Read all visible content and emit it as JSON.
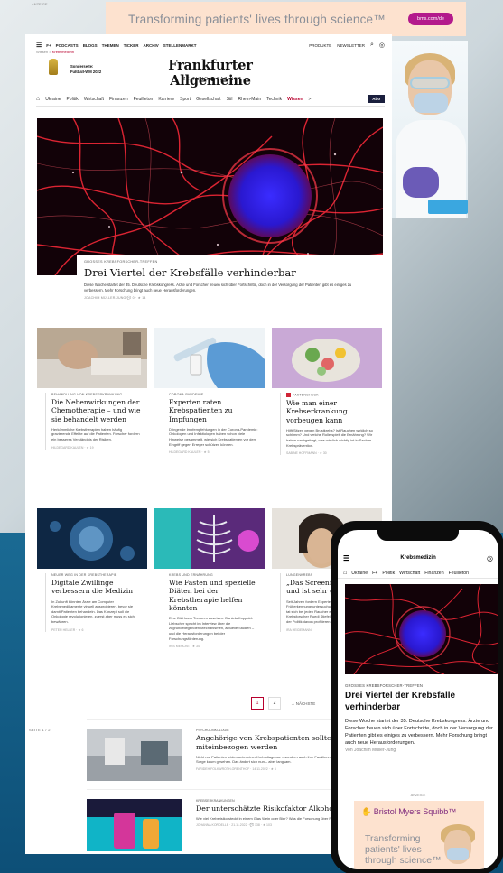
{
  "top_ad": {
    "anzeige": "ANZEIGE",
    "text": "Transforming patients' lives through science™",
    "button": "bms.com/de"
  },
  "header": {
    "nav_items": [
      "F+",
      "PODCASTS",
      "BLOGS",
      "THEMEN",
      "TICKER",
      "ARCHIV",
      "STELLENMARKT"
    ],
    "produkte": "PRODUKTE",
    "newsletter": "NEWSLETTER",
    "breadcrumb_root": "Wissen",
    "breadcrumb_sep": ">",
    "breadcrumb_active": "Krebsmedizin",
    "wm_label_1": "Sonderseite:",
    "wm_label_2": "Fußball-WM 2022",
    "logo": "Frankfurter Allgemeine",
    "logo_sub_left": "ZEITUNG",
    "logo_sub_right": "FAZ.NET"
  },
  "section_nav": {
    "items": [
      "Ukraine",
      "Politik",
      "Wirtschaft",
      "Finanzen",
      "Feuilleton",
      "Karriere",
      "Sport",
      "Gesellschaft",
      "Stil",
      "Rhein-Main",
      "Technik"
    ],
    "active": "Wissen",
    "more": ">",
    "abo": "Abo"
  },
  "hero": {
    "kicker": "GROSSES KREBSFORSCHER-TREFFEN",
    "title": "Drei Viertel der Krebsfälle verhinderbar",
    "text": "Diese Woche startet der 35. Deutsche Krebskongress. Ärzte und Forscher freuen sich über Fortschritte, doch in der Versorgung der Patienten gibt es einiges zu verbessern. Mehr Forschung bringt auch neue Herausforderungen.",
    "byline": "JOACHIM MÜLLER-JUNG",
    "stats": "💬 0 · ★ 14"
  },
  "cards": [
    {
      "kicker": "BEHANDLUNG VON KREBSERKRANKUNG",
      "title": "Die Nebenwirkungen der Chemotherapie – und wie sie behandelt werden",
      "text": "Herkömmliche Krebstherapien haben häufig gravierende Effekte auf die Patienten. Forscher fordern ein besseres Verständnis der Risiken.",
      "byline": "HILDEGARD KAULEN · ★ 19"
    },
    {
      "kicker": "CORONA-PANDEMIE",
      "title": "Experten raten Krebspatienten zu Impfungen",
      "text": "Dringende Impfempfehlungen in der Corona-Pandemie: Onkologen und Infektiologen haben schon viele Hinweise gesammelt, wie sich Krebspatienten vor dem Eingriff gegen Erreger schützen können.",
      "byline": "HILDEGARD KAULEN · ★ 5"
    },
    {
      "kicker": "FAKTENCHECK",
      "title": "Wie man einer Krebserkrankung vorbeugen kann",
      "text": "Hilft Sitzen gegen Brustkrebs? Ist Rauchen wirklich so schlimm? Und welche Rolle spielt die Ernährung? Wir haben nachgefragt, was wirklich wichtig ist in Sachen Krebsprävention.",
      "byline": "SABINE HOFFMANN · ★ 30"
    },
    {
      "kicker": "NEUER WEG IN DER KREBSTHERAPIE",
      "title": "Digitale Zwillinge verbessern die Medizin",
      "text": "In Zukunft könnten Ärzte am Computer Krebsmedikamente virtuell ausprobieren, bevor sie damit Patienten behandeln. Das Konzept soll die Onkologie revolutionieren, zuerst aber muss es sich bewähren.",
      "byline": "PETER HELLER · ★ 6"
    },
    {
      "kicker": "KREBS UND ERNÄHRUNG",
      "title": "Wie Fasten und spezielle Diäten bei der Krebstherapie helfen könnten",
      "text": "Eine Diät kann Tumoren zusetzen. Daniela Koppold-Liebscher spricht im Interview über die zugrundeliegenden Mechanismen, aktuelle Studien – und die Herausforderungen bei der Forschungsförderung.",
      "byline": "IRIS MENCKE · ★ 34"
    },
    {
      "kicker": "LUNGENKREBS",
      "title": "„Das Screening wirkt – und ist sehr gut“",
      "text": "Seit Jahren fordern Experten eine Früherkennungsuntersuchung für Langenkrebs. Lange tat sich bei jeden Raucher ein. Nun hat der Krebsforscher Ruedi Stiefel ein Screening gegenüber der Politik davon profitieren.",
      "byline": "IRA HEIDEMANN"
    }
  ],
  "pagination": {
    "pages": [
      "1",
      "2"
    ],
    "next": "NÄCHSTE"
  },
  "list": {
    "seite": "SEITE 1 / 2",
    "items": [
      {
        "kicker": "PSYCHOONKOLOGIE",
        "title": "Angehörige von Krebspatienten sollten miteinbezogen werden",
        "text": "Nicht nur Patienten leiden unter einer Krebsdiagnose – sondern auch ihre Familienmitglieder. Lange wurde ihre Sorge kaum gesehen. Das ändert sich nun – aber langsam.",
        "byline": "FARIDEH FOLKWROTH-ORENTHOF · 14.11.2022 · ★ 6"
      },
      {
        "kicker": "KREBSERKRANKUNGEN",
        "title": "Der unterschätzte Risikofaktor Alkohol",
        "text": "Wie viel Krebsrisiko steckt in einem Glas Wein oder Bier? Was die Forschung über Prävention wissen weiß.",
        "byline": "JOHANNA KORDELLE · 21.11.2022 · 💬 138 · ★ 103"
      }
    ]
  },
  "mobile": {
    "title": "Krebsmedizin",
    "nav": [
      "Ukraine",
      "F+",
      "Politik",
      "Wirtschaft",
      "Finanzen",
      "Feuilleton"
    ],
    "kicker": "GROSSES KREBSFORSCHER-TREFFEN",
    "headline": "Drei Viertel der Krebsfälle verhinderbar",
    "text": "Diese Woche startet der 35. Deutsche Krebskongress. Ärzte und Forscher freuen sich über Fortschritte, doch in der Versorgung der Patienten gibt es einiges zu verbessern. Mehr Forschung bringt auch neue Herausforderungen.",
    "byline": "Von Joachim Müller-Jung",
    "anzeige": "ANZEIGE",
    "ad_brand": "Bristol Myers Squibb™",
    "ad_text": "Transforming patients' lives through science™"
  },
  "colors": {
    "accent": "#b8002e",
    "brand_ad": "#b31a8c",
    "ad_bg": "#fde2cf"
  }
}
